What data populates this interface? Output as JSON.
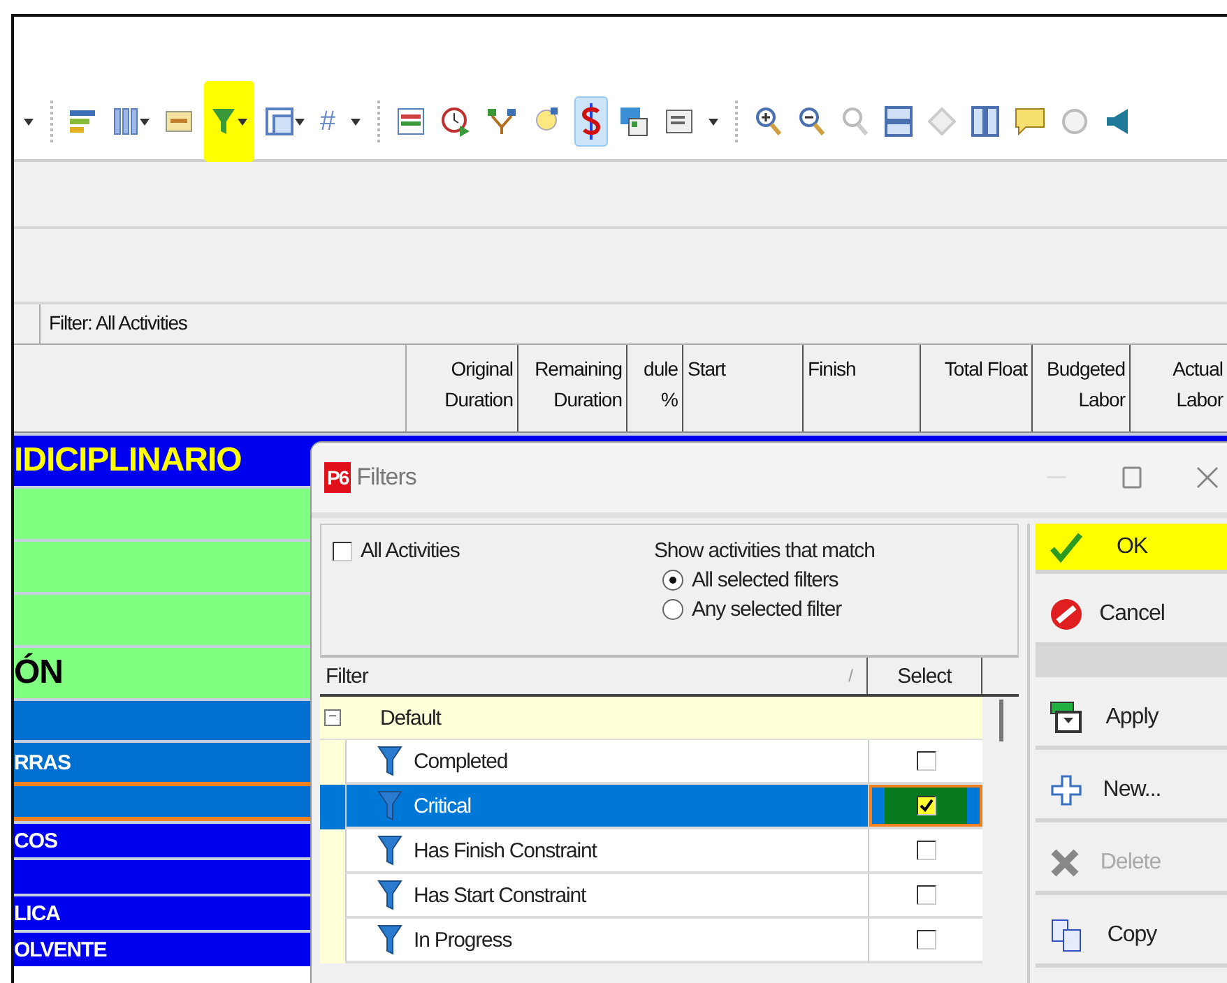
{
  "toolbar": {
    "filter_highlighted": true,
    "cost_pressed": true,
    "hash_label": "#"
  },
  "filter_bar": {
    "label": "Filter: All Activities"
  },
  "columns": [
    {
      "label": "Original Duration",
      "kind": "number"
    },
    {
      "label": "Remaining Duration",
      "kind": "number"
    },
    {
      "label": "dule %",
      "kind": "number"
    },
    {
      "label": "Start",
      "kind": "date"
    },
    {
      "label": "Finish",
      "kind": "date"
    },
    {
      "label": "Total Float",
      "kind": "number"
    },
    {
      "label": "Budgeted Labor",
      "kind": "number"
    },
    {
      "label": "Actual Labor",
      "kind": "number"
    }
  ],
  "activity_rows": [
    {
      "kind": "project",
      "text": "IDICIPLINARIO"
    },
    {
      "kind": "green"
    },
    {
      "kind": "green"
    },
    {
      "kind": "green"
    },
    {
      "kind": "green",
      "text": "ÓN"
    },
    {
      "kind": "mid"
    },
    {
      "kind": "mid",
      "text": "RRAS"
    },
    {
      "kind": "critical"
    },
    {
      "kind": "blue",
      "text": "COS"
    },
    {
      "kind": "blue"
    },
    {
      "kind": "blue",
      "text": "LICA"
    },
    {
      "kind": "blue",
      "text": "OLVENTE"
    }
  ],
  "dialog": {
    "logo": "P6",
    "title": "Filters",
    "all_activities": {
      "label": "All Activities",
      "checked": false
    },
    "match": {
      "label": "Show activities that match",
      "options": [
        {
          "label": "All selected filters",
          "selected": true
        },
        {
          "label": "Any selected filter",
          "selected": false
        }
      ]
    },
    "table": {
      "columns": [
        "Filter",
        "Select"
      ],
      "sort_mark": "/",
      "groups": [
        {
          "label": "Default",
          "expanded": true,
          "expander": "−",
          "children": [
            {
              "label": "Completed",
              "checked": false,
              "selected": false
            },
            {
              "label": "Critical",
              "checked": true,
              "selected": true
            },
            {
              "label": "Has Finish Constraint",
              "checked": false,
              "selected": false
            },
            {
              "label": "Has Start Constraint",
              "checked": false,
              "selected": false
            },
            {
              "label": "In Progress",
              "checked": false,
              "selected": false
            }
          ]
        }
      ]
    },
    "buttons": [
      {
        "kind": "ok",
        "label": "OK",
        "highlighted": true,
        "disabled": false
      },
      {
        "kind": "cancel",
        "label": "Cancel",
        "highlighted": false,
        "disabled": false
      },
      {
        "kind": "apply",
        "label": "Apply",
        "highlighted": false,
        "disabled": false
      },
      {
        "kind": "new",
        "label": "New...",
        "highlighted": false,
        "disabled": false
      },
      {
        "kind": "delete",
        "label": "Delete",
        "highlighted": false,
        "disabled": true
      },
      {
        "kind": "copy",
        "label": "Copy",
        "highlighted": false,
        "disabled": false
      }
    ]
  }
}
